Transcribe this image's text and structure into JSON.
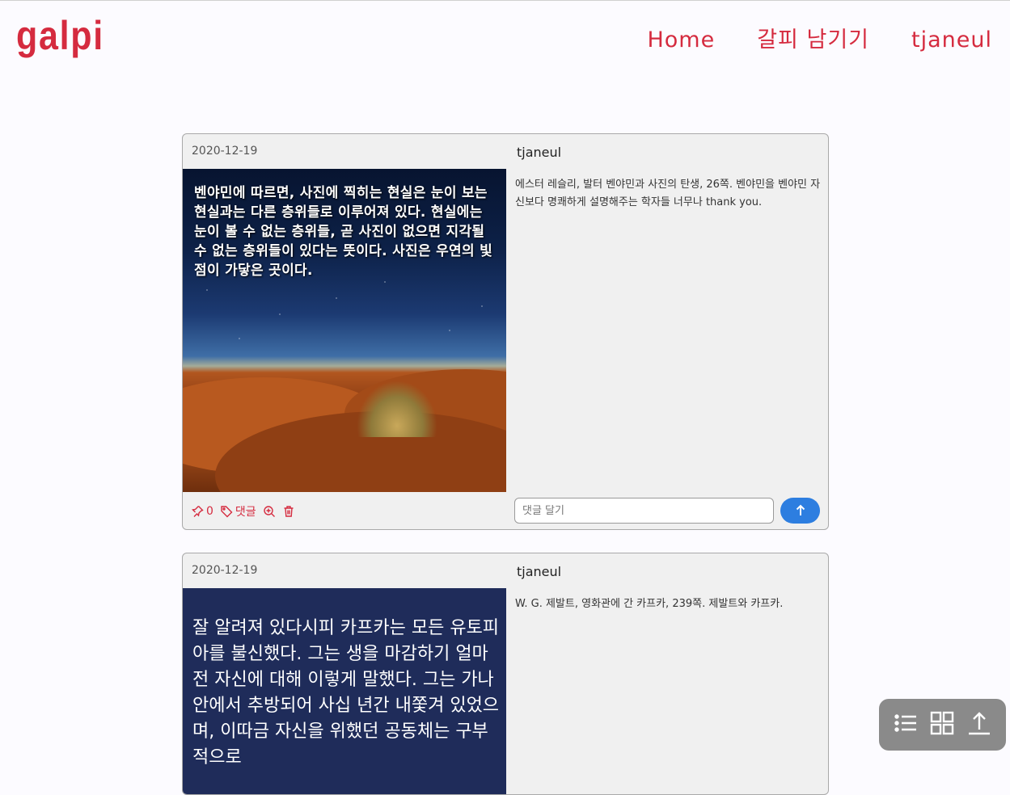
{
  "header": {
    "logo": "galpi",
    "nav": [
      "Home",
      "갈피 남기기",
      "tjaneul"
    ]
  },
  "posts": [
    {
      "date": "2020-12-19",
      "author": "tjaneul",
      "text": "에스터 레슬리, 발터 벤야민과 사진의 탄생, 26쪽. 벤야민을 벤야민 자신보다 명쾌하게 설명해주는 학자들 너무나 thank you.",
      "image_text": "벤야민에 따르면, 사진에 찍히는 현실은 눈이 보는 현실과는 다른 층위들로 이루어져 있다. 현실에는 눈이 볼 수 없는 층위들, 곧 사진이 없으면 지각될 수 없는 층위들이 있다는 뜻이다. 사진은 우연의 빛점이 가닿은 곳이다.",
      "pin_count": "0",
      "comment_label": "댓글",
      "comment_placeholder": "댓글 달기"
    },
    {
      "date": "2020-12-19",
      "author": "tjaneul",
      "text": "W. G. 제발트, 영화관에 간 카프카, 239쪽. 제발트와 카프카.",
      "image_text": "잘 알려져 있다시피 카프카는 모든 유토피아를 불신했다. 그는 생을 마감하기 얼마 전 자신에 대해 이렇게 말했다. 그는 가나안에서 추방되어 사십 년간 내쫓겨 있었으며, 이따금 자신을 위했던 공동체는 구부적으로"
    }
  ],
  "float_toolbar": {
    "icons": [
      "list-icon",
      "grid-icon",
      "scroll-top-icon"
    ]
  },
  "colors": {
    "brand": "#d52b3f",
    "send_button": "#2d7ee0",
    "card_bg": "#f0f0f0",
    "toolbar_bg": "#8a8a8a"
  }
}
